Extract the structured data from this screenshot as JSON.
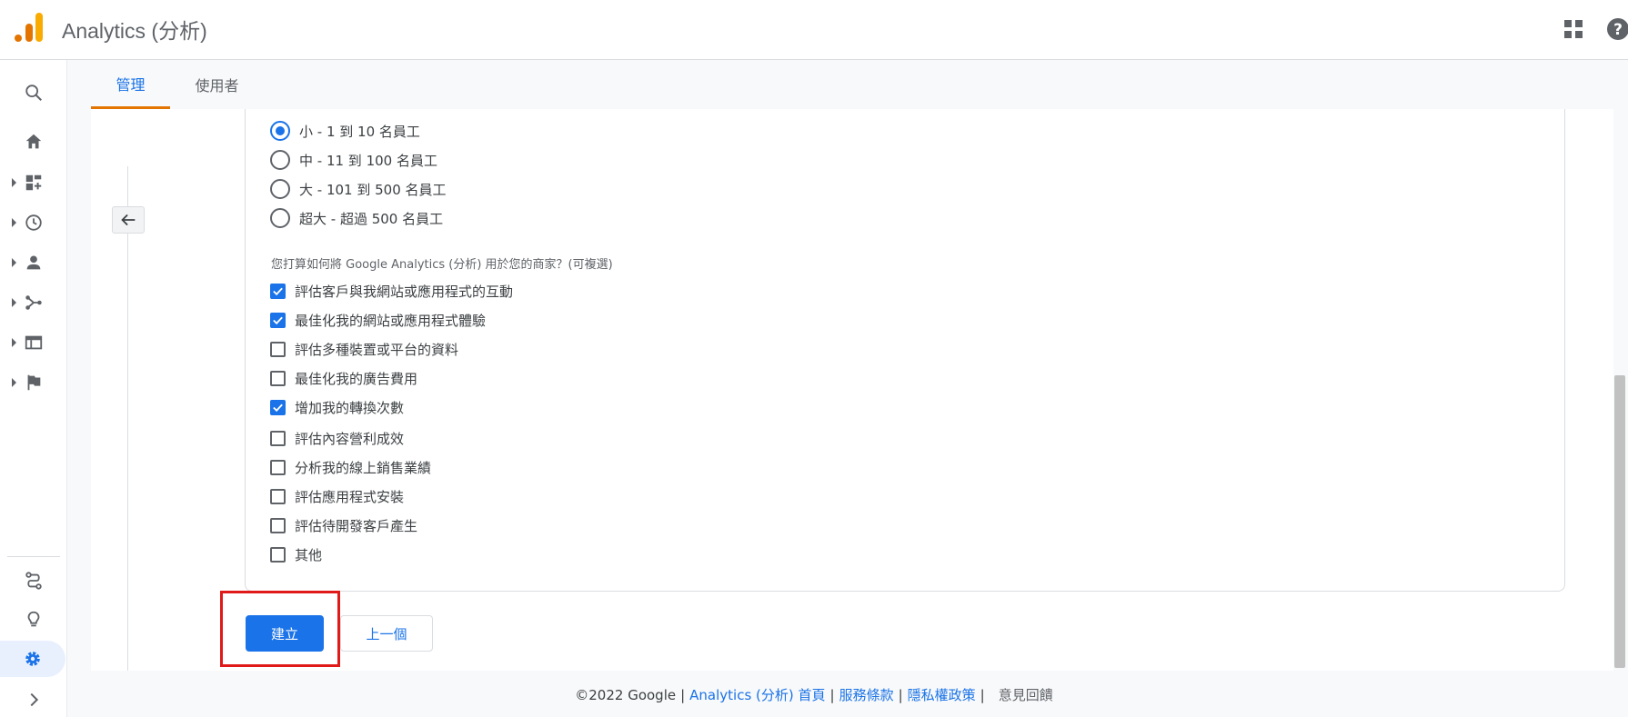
{
  "app": {
    "title": "Analytics (分析)"
  },
  "tabs": [
    {
      "label": "管理"
    },
    {
      "label": "使用者"
    }
  ],
  "company_size": {
    "options": [
      {
        "label": "小 - 1 到 10 名員工",
        "checked": true
      },
      {
        "label": "中 - 11 到 100 名員工",
        "checked": false
      },
      {
        "label": "大 - 101 到 500 名員工",
        "checked": false
      },
      {
        "label": "超大 - 超過 500 名員工",
        "checked": false
      }
    ]
  },
  "usage": {
    "question": "您打算如何將 Google Analytics (分析) 用於您的商家？(可複選)",
    "options": [
      {
        "label": "評估客戶與我網站或應用程式的互動",
        "checked": true
      },
      {
        "label": "最佳化我的網站或應用程式體驗",
        "checked": true
      },
      {
        "label": "評估多種裝置或平台的資料",
        "checked": false
      },
      {
        "label": "最佳化我的廣告費用",
        "checked": false
      },
      {
        "label": "增加我的轉換次數",
        "checked": true
      },
      {
        "label": "評估內容營利成效",
        "checked": false
      },
      {
        "label": "分析我的線上銷售業績",
        "checked": false
      },
      {
        "label": "評估應用程式安裝",
        "checked": false
      },
      {
        "label": "評估待開發客戶產生",
        "checked": false
      },
      {
        "label": "其他",
        "checked": false
      }
    ]
  },
  "actions": {
    "create": "建立",
    "previous": "上一個"
  },
  "footer": {
    "copyright": "©2022 Google",
    "home": "Analytics (分析) 首頁",
    "terms": "服務條款",
    "privacy": "隱私權政策",
    "feedback": "意見回饋"
  },
  "colors": {
    "accent": "#1a73e8",
    "highlight": "#e01919",
    "tab_indicator": "#e37400"
  }
}
